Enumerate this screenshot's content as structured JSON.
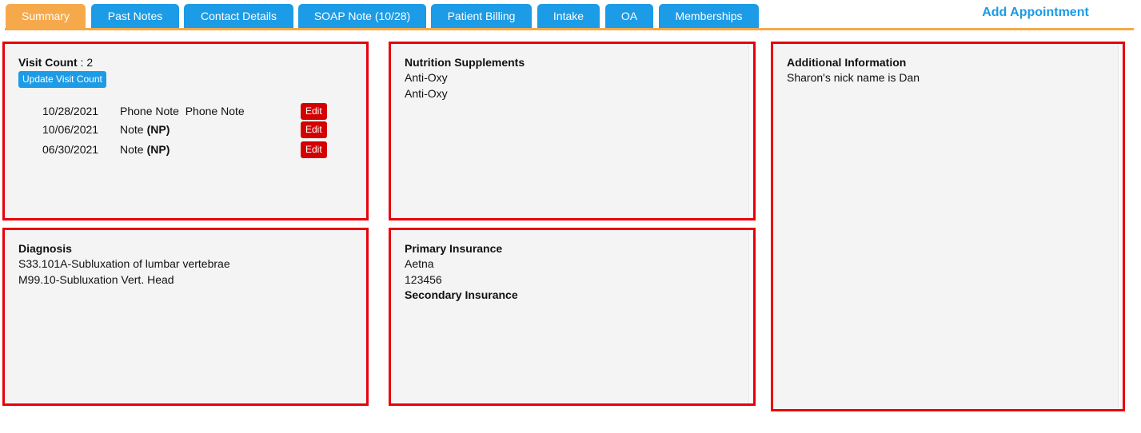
{
  "tabs": [
    {
      "label": "Summary",
      "active": true
    },
    {
      "label": "Past Notes"
    },
    {
      "label": "Contact Details"
    },
    {
      "label": "SOAP Note (10/28)"
    },
    {
      "label": "Patient Billing"
    },
    {
      "label": "Intake"
    },
    {
      "label": "OA"
    },
    {
      "label": "Memberships"
    }
  ],
  "add_appointment": "Add Appointment",
  "visits": {
    "count_label": "Visit Count",
    "count_sep": " : ",
    "count": "2",
    "update_button": "Update Visit Count",
    "rows": [
      {
        "date": "10/28/2021",
        "desc": "Phone Note  Phone Note",
        "np": "",
        "edit": "Edit"
      },
      {
        "date": "10/06/2021",
        "desc": "Note",
        "np": "(NP)",
        "edit": "Edit"
      },
      {
        "date": "06/30/2021",
        "desc": "Note",
        "np": "(NP)",
        "edit": "Edit"
      }
    ]
  },
  "nutrition": {
    "title": "Nutrition Supplements",
    "items": [
      "Anti-Oxy",
      "Anti-Oxy"
    ]
  },
  "additional": {
    "title": "Additional Information",
    "text": "Sharon's nick name is Dan"
  },
  "diagnosis": {
    "title": "Diagnosis",
    "items": [
      "S33.101A-Subluxation of lumbar vertebrae",
      "M99.10-Subluxation Vert. Head"
    ]
  },
  "insurance": {
    "primary_title": "Primary Insurance",
    "primary_name": "Aetna",
    "primary_id": "123456",
    "secondary_title": "Secondary Insurance"
  },
  "colors": {
    "tab_blue": "#1c9be6",
    "tab_active": "#f5a94a",
    "panel_border": "#e8000b",
    "edit_red": "#d40000"
  }
}
